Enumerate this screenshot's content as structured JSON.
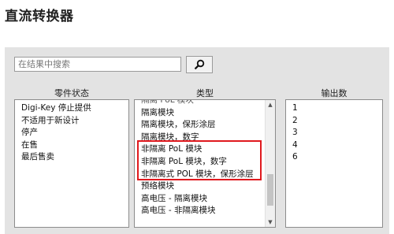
{
  "page": {
    "title": "直流转换器"
  },
  "search": {
    "placeholder": "在结果中搜索",
    "button_icon": "search-icon"
  },
  "columns": {
    "part_status": {
      "header": "零件状态",
      "items": [
        "Digi-Key 停止提供",
        "不适用于新设计",
        "停产",
        "在售",
        "最后售卖"
      ]
    },
    "type": {
      "header": "类型",
      "partial_top_item": "隔离 PoL 模块",
      "items": [
        "隔离模块",
        "隔离模块，保形涂层",
        "隔离模块，数字",
        "非隔离 PoL 模块",
        "非隔离 PoL 模块，数字",
        "非隔离式 POL 模块，保形涂层",
        "预络模块",
        "高电压 - 隔离模块",
        "高电压 - 非隔离模块"
      ],
      "scroll_position": 0.85
    },
    "outputs": {
      "header": "输出数",
      "items": [
        "1",
        "2",
        "3",
        "4",
        "6"
      ]
    }
  },
  "colors": {
    "highlight": "#e0191e",
    "panel": "#e3e3e3"
  }
}
